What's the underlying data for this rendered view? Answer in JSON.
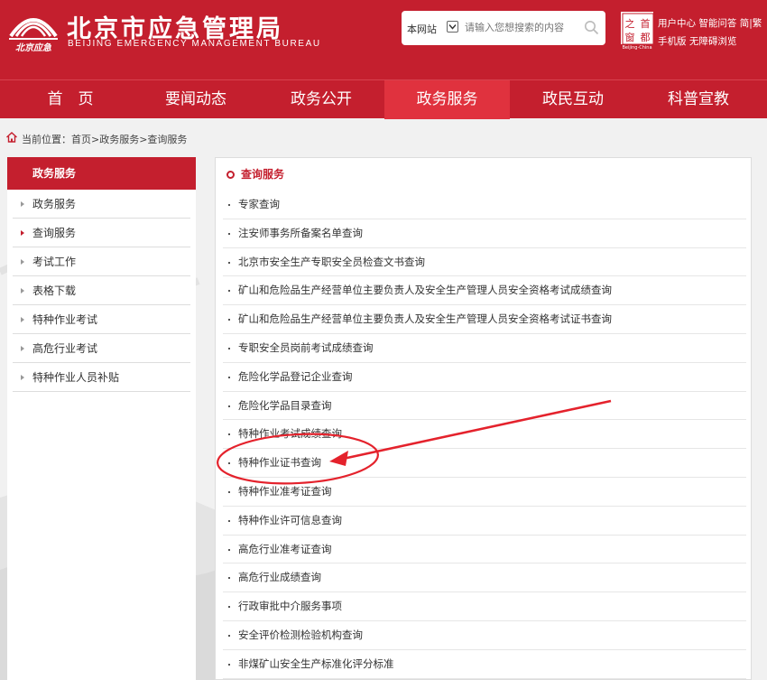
{
  "header": {
    "org_cn": "北京市应急管理局",
    "org_en": "BEIJING  EMERGENCY MANAGEMENT BUREAU",
    "logo_text": "北京应急",
    "search": {
      "scope": "本网站",
      "placeholder": "请输入您想搜索的内容"
    },
    "capital_seal": {
      "chars": [
        "之",
        "首",
        "窗",
        "都"
      ],
      "caption": "Beijing-China"
    },
    "links_row1": [
      "用户中心",
      "智能问答",
      "简",
      "繁"
    ],
    "links_row2": [
      "手机版",
      "无障碍浏览"
    ]
  },
  "nav": [
    "首　页",
    "要闻动态",
    "政务公开",
    "政务服务",
    "政民互动",
    "科普宣教"
  ],
  "nav_active_index": 3,
  "breadcrumb": "当前位置：首页>政务服务>查询服务",
  "sidebar": {
    "title": "政务服务",
    "items": [
      "政务服务",
      "查询服务",
      "考试工作",
      "表格下载",
      "特种作业考试",
      "高危行业考试",
      "特种作业人员补贴"
    ],
    "active_index": 1
  },
  "main": {
    "title": "查询服务",
    "items": [
      "专家查询",
      "注安师事务所备案名单查询",
      "北京市安全生产专职安全员检查文书查询",
      "矿山和危险品生产经营单位主要负责人及安全生产管理人员安全资格考试成绩查询",
      "矿山和危险品生产经营单位主要负责人及安全生产管理人员安全资格考试证书查询",
      "专职安全员岗前考试成绩查询",
      "危险化学品登记企业查询",
      "危险化学品目录查询",
      "特种作业考试成绩查询",
      "特种作业证书查询",
      "特种作业准考证查询",
      "特种作业许可信息查询",
      "高危行业准考证查询",
      "高危行业成绩查询",
      "行政审批中介服务事项",
      "安全评价检测检验机构查询",
      "非煤矿山安全生产标准化评分标准"
    ]
  },
  "colors": {
    "brand_red": "#c41f2e",
    "nav_active": "#e0323e",
    "annotation_red": "#e4222c"
  }
}
